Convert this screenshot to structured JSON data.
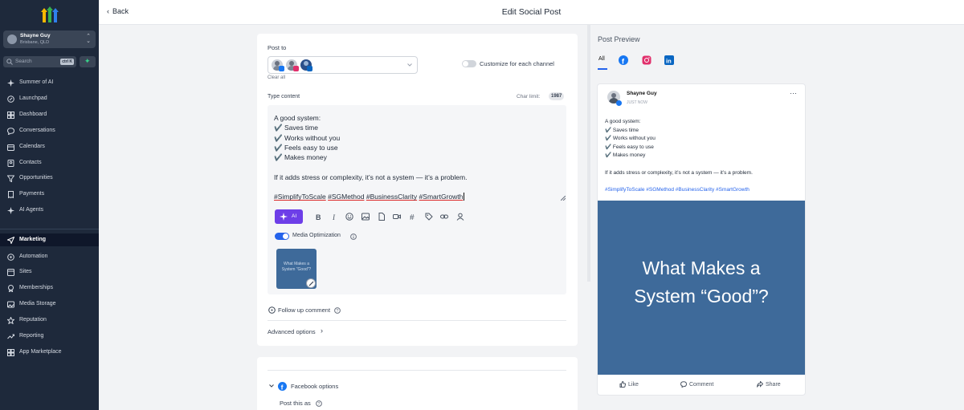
{
  "sidebar": {
    "account": {
      "name": "Shayne Guy",
      "location": "Brisbane, QLD"
    },
    "search": {
      "placeholder": "Search",
      "shortcut": "ctrl K"
    },
    "items": [
      {
        "label": "Summer of AI",
        "icon": "sparkle-icon"
      },
      {
        "label": "Launchpad",
        "icon": "rocket-icon"
      },
      {
        "label": "Dashboard",
        "icon": "dashboard-icon"
      },
      {
        "label": "Conversations",
        "icon": "chat-icon"
      },
      {
        "label": "Calendars",
        "icon": "calendar-icon"
      },
      {
        "label": "Contacts",
        "icon": "contacts-icon"
      },
      {
        "label": "Opportunities",
        "icon": "funnel-icon"
      },
      {
        "label": "Payments",
        "icon": "receipt-icon"
      },
      {
        "label": "AI Agents",
        "icon": "sparkle-icon"
      },
      {
        "label": "Marketing",
        "icon": "send-icon",
        "active": true
      },
      {
        "label": "Automation",
        "icon": "automation-icon"
      },
      {
        "label": "Sites",
        "icon": "sites-icon"
      },
      {
        "label": "Memberships",
        "icon": "memberships-icon"
      },
      {
        "label": "Media Storage",
        "icon": "image-icon"
      },
      {
        "label": "Reputation",
        "icon": "star-icon"
      },
      {
        "label": "Reporting",
        "icon": "trend-icon"
      },
      {
        "label": "App Marketplace",
        "icon": "apps-icon"
      }
    ]
  },
  "header": {
    "back_label": "Back",
    "title": "Edit Social Post"
  },
  "editor": {
    "post_to_label": "Post to",
    "clear_all": "Clear all",
    "customize_label": "Customize for each channel",
    "type_content_label": "Type content",
    "char_limit_label": "Char limit:",
    "char_limit_value": "1987",
    "content_lines": [
      "A good system:",
      "✔️ Saves time",
      "✔️ Works without you",
      "✔️ Feels easy to use",
      "✔️ Makes money",
      "",
      "If it adds stress or complexity, it’s not a system — it’s a problem.",
      ""
    ],
    "hashtags": [
      "#SimplifyToScale",
      "#SGMethod",
      "#BusinessClarity",
      "#SmartGrowth"
    ],
    "ai_label": "AI",
    "media_optimization_label": "Media Optimization",
    "media_thumb_text": "What Makes a System “Good”?",
    "follow_up_label": "Follow up comment",
    "advanced_label": "Advanced options",
    "facebook_options_label": "Facebook options",
    "post_this_as_label": "Post this as"
  },
  "preview": {
    "title": "Post Preview",
    "tabs": [
      "All",
      "facebook",
      "instagram",
      "linkedin"
    ],
    "author": "Shayne Guy",
    "time": "JUST NOW",
    "more": "···",
    "lines": [
      "A good system:",
      "✔️ Saves time",
      "✔️ Works without you",
      "✔️ Feels easy to use",
      "✔️ Makes money"
    ],
    "body": "If it adds stress or complexity, it’s not a system — it’s a problem.",
    "hashtags": "#SimplifyToScale #SGMethod #BusinessClarity #SmartGrowth",
    "image_text_1": "What Makes a",
    "image_text_2": "System “Good”?",
    "actions": {
      "like": "Like",
      "comment": "Comment",
      "share": "Share"
    }
  },
  "colors": {
    "sidebar": "#1e293b",
    "accent": "#2563eb",
    "ai": "#6d3ee8",
    "image_bg": "#3e6a9a",
    "facebook": "#1877f2",
    "instagram": "#e1306c",
    "linkedin": "#0a66c2"
  }
}
